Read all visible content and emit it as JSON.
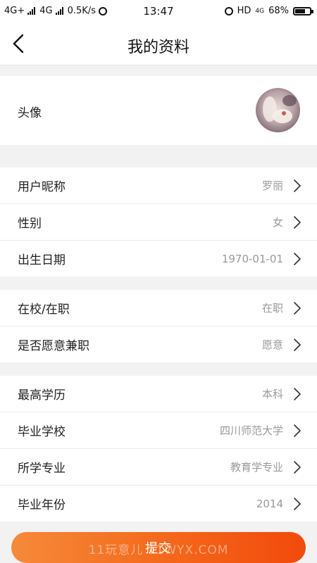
{
  "status_bar": {
    "network_left": "4G+",
    "network_mid": "4G",
    "speed": "0.5K/s",
    "time": "13:47",
    "hd": "HD",
    "network_right": "4G",
    "battery": "68%"
  },
  "nav": {
    "title": "我的资料",
    "back_icon": "chevron-left-icon"
  },
  "avatar_row": {
    "label": "头像"
  },
  "profile": {
    "nickname": {
      "label": "用户昵称",
      "value": "罗丽"
    },
    "gender": {
      "label": "性别",
      "value": "女"
    },
    "birth_date": {
      "label": "出生日期",
      "value": "1970-01-01"
    }
  },
  "status": {
    "school_or_work": {
      "label": "在校/在职",
      "value": "在职"
    },
    "part_time": {
      "label": "是否愿意兼职",
      "value": "愿意"
    }
  },
  "education": {
    "degree": {
      "label": "最高学历",
      "value": "本科"
    },
    "school": {
      "label": "毕业学校",
      "value": "四川师范大学"
    },
    "major": {
      "label": "所学专业",
      "value": "教育学专业"
    },
    "grad_year": {
      "label": "毕业年份",
      "value": "2014"
    }
  },
  "submit": {
    "label": "提交",
    "watermark": "11玩意儿 11WYX.COM"
  },
  "colors": {
    "accent_start": "#f58a3a",
    "accent_end": "#f24a0c",
    "value_text": "#999999",
    "background": "#f2f2f2"
  }
}
